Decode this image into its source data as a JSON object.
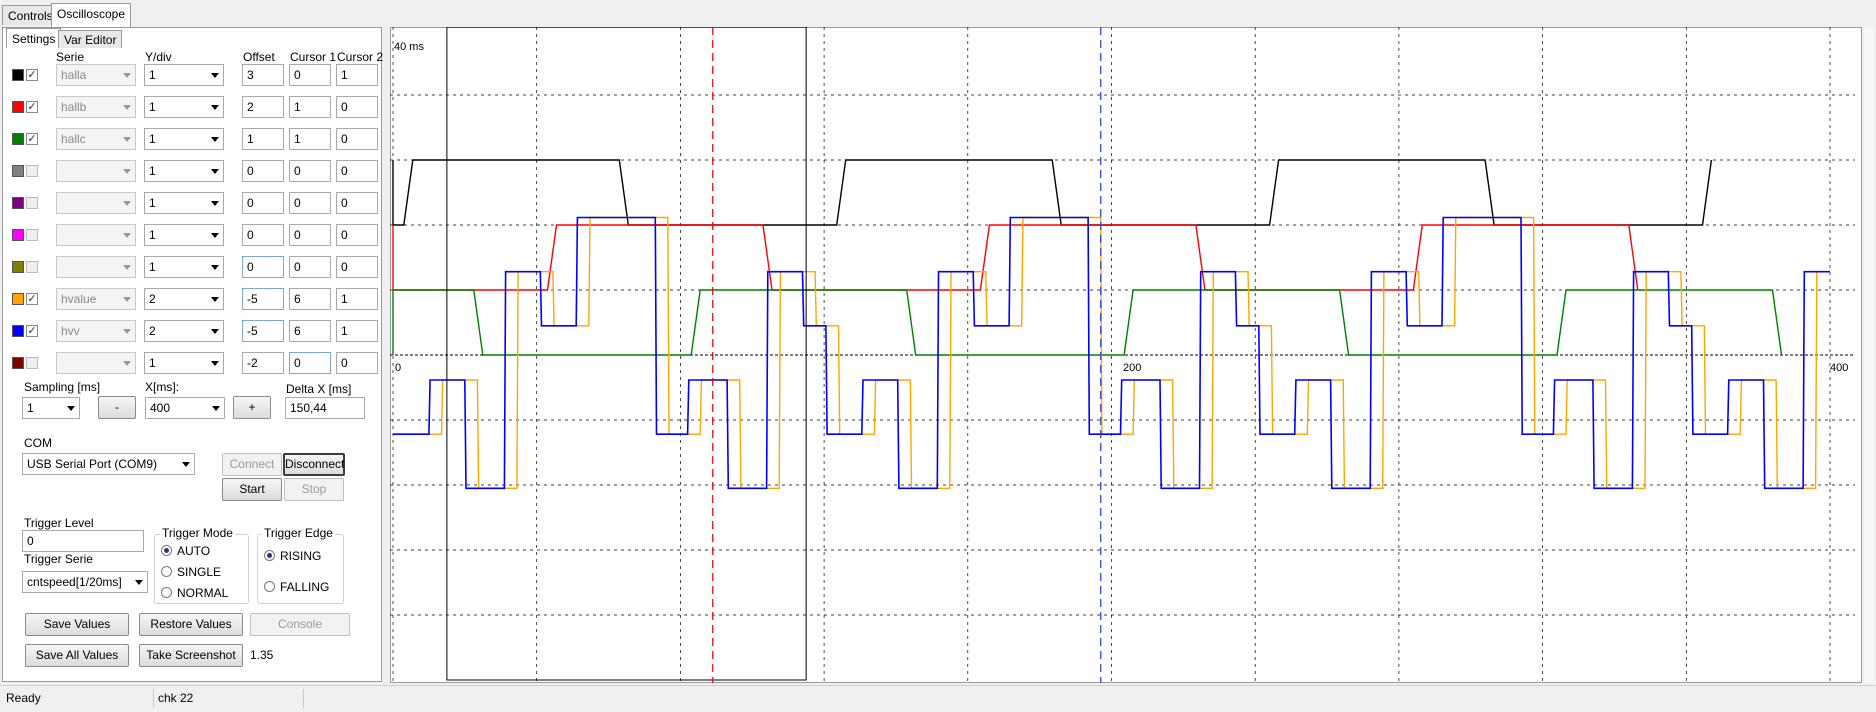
{
  "tabs": {
    "controls": "Controls",
    "oscilloscope": "Oscilloscope"
  },
  "subtabs": {
    "settings": "Settings",
    "var_editor": "Var Editor"
  },
  "headers": {
    "serie": "Serie",
    "ydiv": "Y/div",
    "offset": "Offset",
    "cursor1": "Cursor 1",
    "cursor2": "Cursor 2"
  },
  "series": [
    {
      "color": "#000000",
      "checked": true,
      "serie": "halla",
      "ydiv": "1",
      "offset": "3",
      "cursor1": "0",
      "cursor2": "1"
    },
    {
      "color": "#ff0000",
      "checked": true,
      "serie": "hallb",
      "ydiv": "1",
      "offset": "2",
      "cursor1": "1",
      "cursor2": "0"
    },
    {
      "color": "#008000",
      "checked": true,
      "serie": "hallc",
      "ydiv": "1",
      "offset": "1",
      "cursor1": "1",
      "cursor2": "0"
    },
    {
      "color": "#808080",
      "checked": false,
      "serie": "",
      "ydiv": "1",
      "offset": "0",
      "cursor1": "0",
      "cursor2": "0"
    },
    {
      "color": "#800080",
      "checked": false,
      "serie": "",
      "ydiv": "1",
      "offset": "0",
      "cursor1": "0",
      "cursor2": "0"
    },
    {
      "color": "#ff00ff",
      "checked": false,
      "serie": "",
      "ydiv": "1",
      "offset": "0",
      "cursor1": "0",
      "cursor2": "0"
    },
    {
      "color": "#808000",
      "checked": false,
      "serie": "",
      "ydiv": "1",
      "offset": "0",
      "cursor1": "0",
      "cursor2": "0"
    },
    {
      "color": "#ffa500",
      "checked": true,
      "serie": "hvalue",
      "ydiv": "2",
      "offset": "-5",
      "cursor1": "6",
      "cursor2": "1"
    },
    {
      "color": "#0000ff",
      "checked": true,
      "serie": "hvv",
      "ydiv": "2",
      "offset": "-5",
      "cursor1": "6",
      "cursor2": "1"
    },
    {
      "color": "#800000",
      "checked": false,
      "serie": "",
      "ydiv": "1",
      "offset": "-2",
      "cursor1": "0",
      "cursor2": "0"
    }
  ],
  "sampling": {
    "label": "Sampling [ms]",
    "value": "1"
  },
  "xms": {
    "label": "X[ms]:",
    "value": "400",
    "minus": "-",
    "plus": "+"
  },
  "deltax": {
    "label": "Delta X [ms]",
    "value": "150,44"
  },
  "com": {
    "label": "COM",
    "port": "USB Serial Port (COM9)",
    "connect": "Connect",
    "disconnect": "Disconnect",
    "start": "Start",
    "stop": "Stop"
  },
  "trigger": {
    "level_label": "Trigger Level",
    "level_value": "0",
    "serie_label": "Trigger Serie",
    "serie_value": "cntspeed[1/20ms]",
    "mode_label": "Trigger Mode",
    "modes": [
      "AUTO",
      "SINGLE",
      "NORMAL"
    ],
    "mode_selected": "AUTO",
    "edge_label": "Trigger Edge",
    "edges": [
      "RISING",
      "FALLING"
    ],
    "edge_selected": "RISING"
  },
  "buttons": {
    "save_values": "Save Values",
    "restore_values": "Restore Values",
    "console": "Console",
    "save_all_values": "Save All Values",
    "take_screenshot": "Take Screenshot"
  },
  "version": "1.35",
  "status": {
    "state": "Ready",
    "message": "chk 22"
  },
  "chart_data": {
    "type": "line",
    "title": "40 ms",
    "x_range": [
      0,
      400
    ],
    "x_tick_labels": [
      "0",
      "200",
      "400"
    ],
    "grid": true,
    "cursor1_x": 150.44,
    "cursor2_x": 0,
    "series": [
      {
        "name": "halla",
        "color": "#000000",
        "period": 120.5,
        "phase": 3,
        "high_duration": 60,
        "levels": [
          0,
          1
        ],
        "baseline": 3
      },
      {
        "name": "hallb",
        "color": "#ff0000",
        "period": 120.5,
        "phase": 43,
        "high_duration": 60,
        "levels": [
          0,
          1
        ],
        "baseline": 2
      },
      {
        "name": "hallc",
        "color": "#008000",
        "period": 120.5,
        "phase": 83,
        "high_duration": 60,
        "levels": [
          0,
          1
        ],
        "baseline": 1
      },
      {
        "name": "hvalue",
        "color": "#ffa500",
        "period": 120.5,
        "levels": [
          -1,
          0,
          1,
          2,
          3
        ],
        "baseline": -5
      },
      {
        "name": "hvv",
        "color": "#0000ff",
        "period": 120.5,
        "levels": [
          -1,
          0,
          1,
          2,
          3
        ],
        "baseline": -5
      }
    ]
  }
}
